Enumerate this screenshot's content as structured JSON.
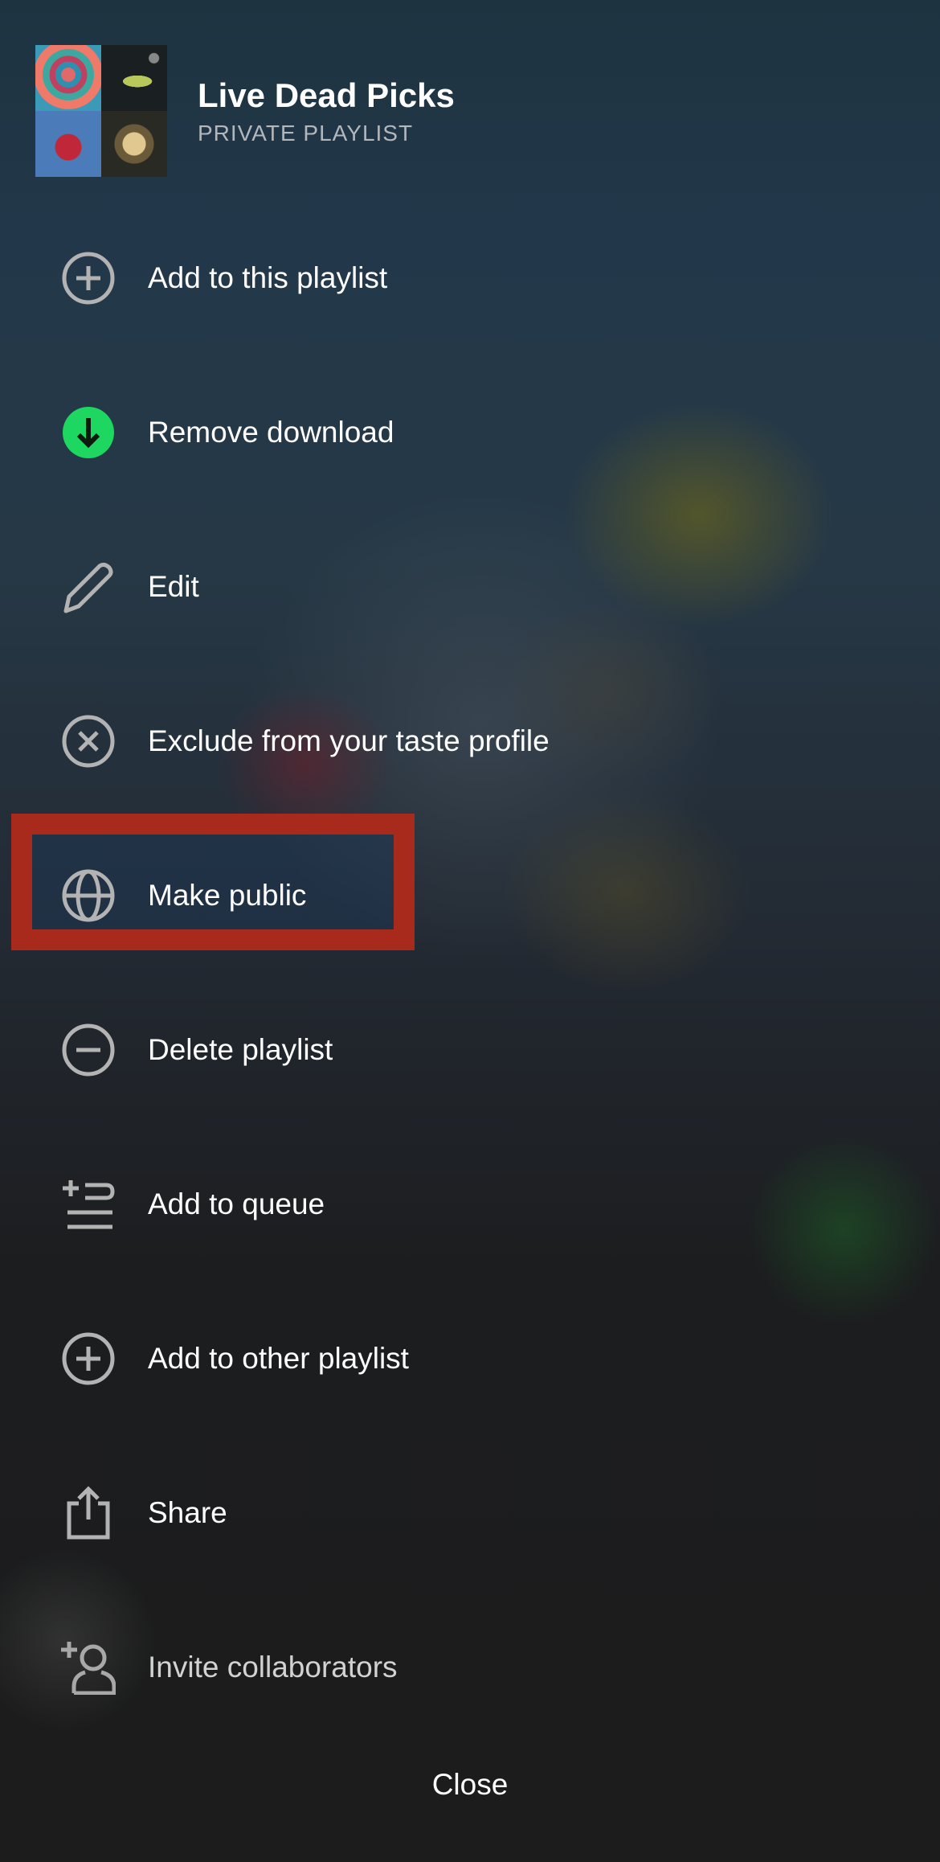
{
  "playlist": {
    "title": "Live Dead Picks",
    "subtitle": "PRIVATE PLAYLIST"
  },
  "menu": {
    "items": [
      {
        "label": "Add to this playlist",
        "icon": "plus-circle-icon"
      },
      {
        "label": "Remove download",
        "icon": "downloaded-icon"
      },
      {
        "label": "Edit",
        "icon": "pencil-icon"
      },
      {
        "label": "Exclude from your taste profile",
        "icon": "x-circle-icon"
      },
      {
        "label": "Make public",
        "icon": "globe-icon"
      },
      {
        "label": "Delete playlist",
        "icon": "minus-circle-icon"
      },
      {
        "label": "Add to queue",
        "icon": "queue-add-icon"
      },
      {
        "label": "Add to other playlist",
        "icon": "plus-circle-icon"
      },
      {
        "label": "Share",
        "icon": "share-icon"
      },
      {
        "label": "Invite collaborators",
        "icon": "add-user-icon"
      }
    ]
  },
  "close_label": "Close",
  "colors": {
    "download_green": "#1ed760",
    "highlight_red": "#a82a1d",
    "icon_gray": "#b3b3b3"
  }
}
